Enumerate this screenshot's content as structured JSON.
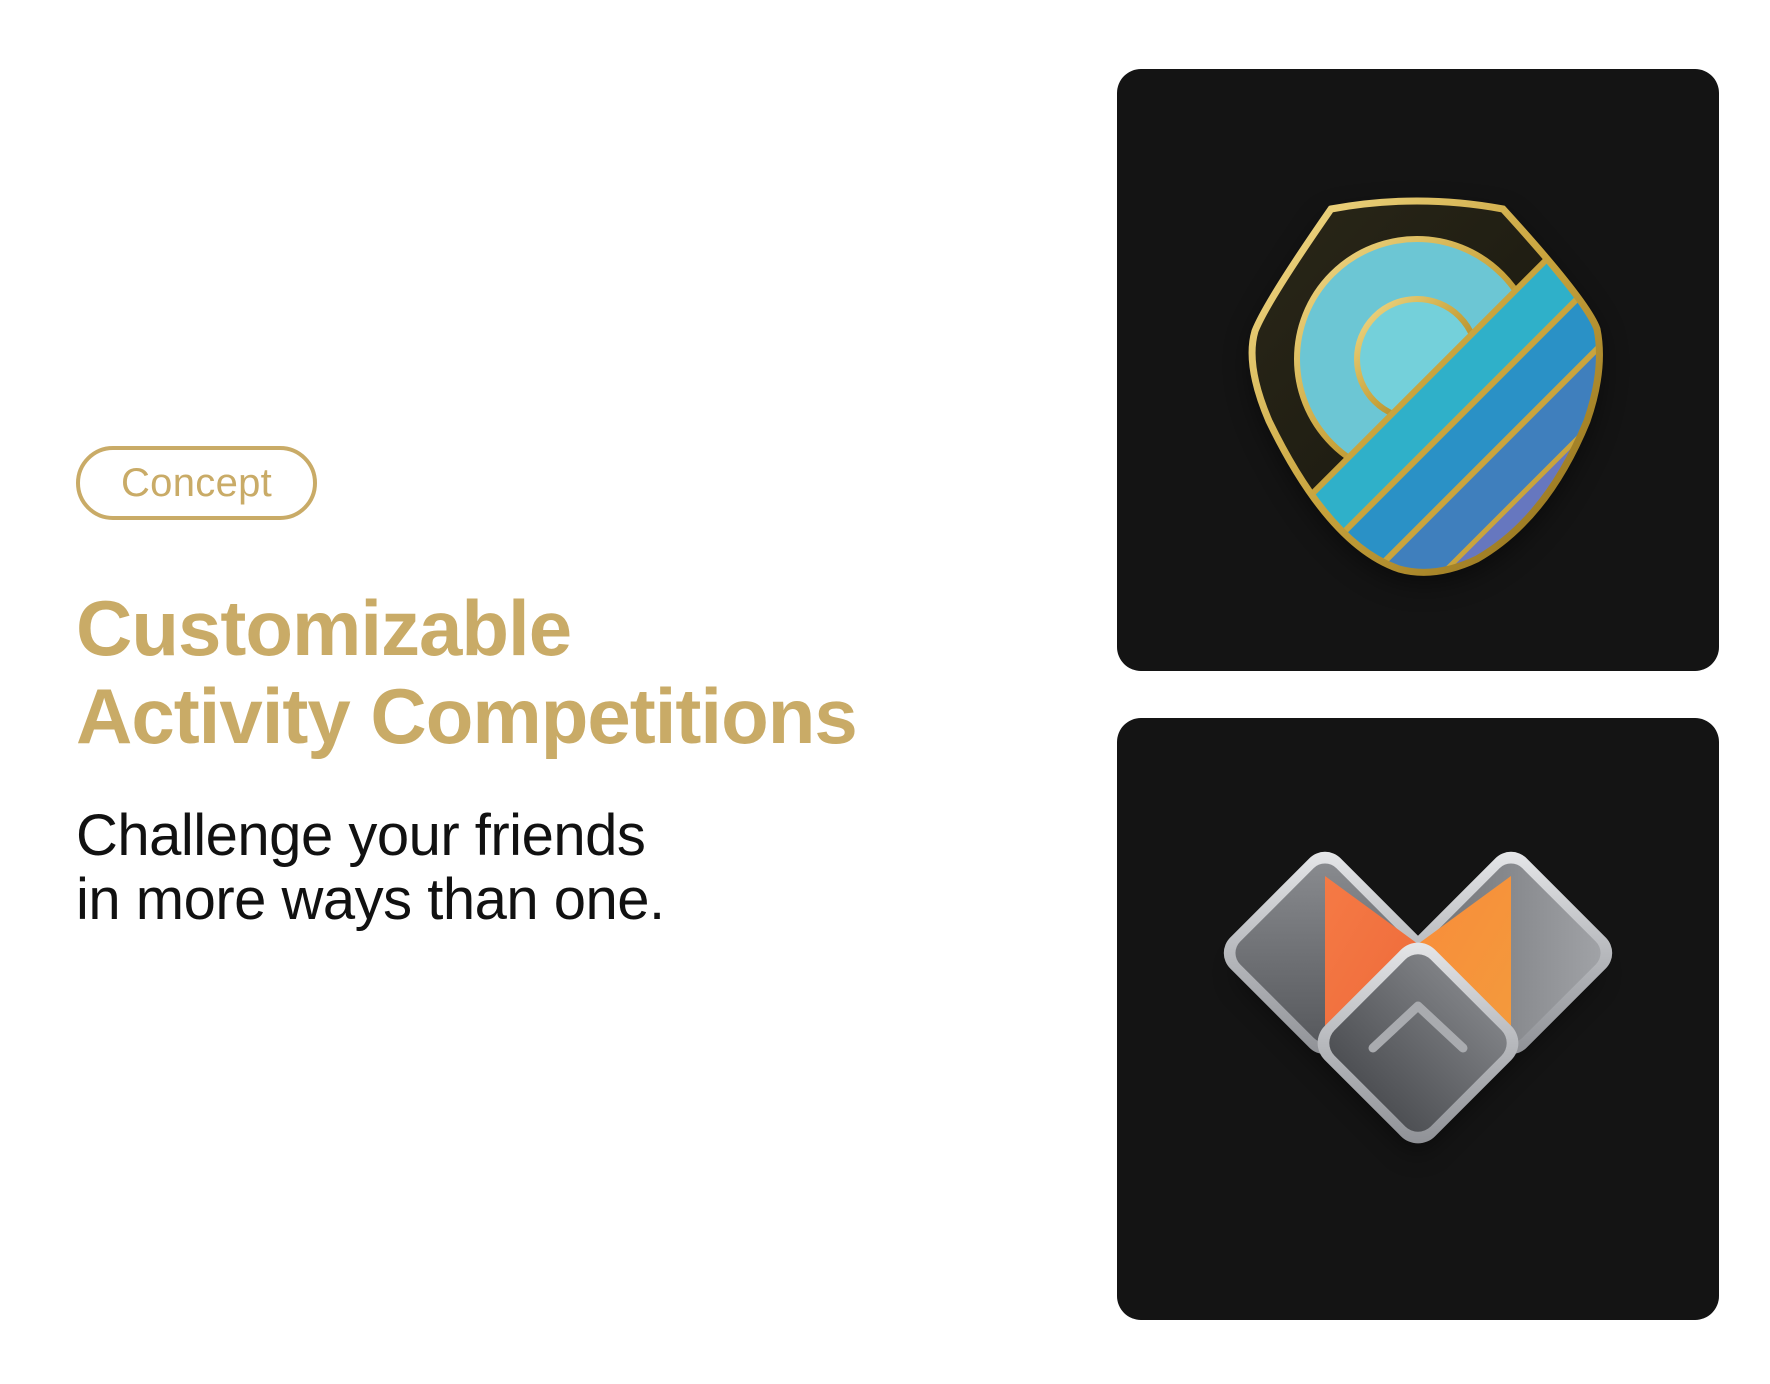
{
  "badge": {
    "label": "Concept"
  },
  "headline": {
    "line1": "Customizable",
    "line2": "Activity Competitions"
  },
  "tagline": {
    "line1": "Challenge your friends",
    "line2": "in more ways than one."
  },
  "colors": {
    "accent_gold": "#c9ab67",
    "text_dark": "#111111",
    "tile_background": "#141414",
    "background": "#ffffff"
  },
  "images": [
    {
      "name": "shield-award-badge",
      "description_icon": "shield-badge-icon"
    },
    {
      "name": "heart-arrow-award-badge",
      "description_icon": "heart-chevron-badge-icon"
    }
  ]
}
